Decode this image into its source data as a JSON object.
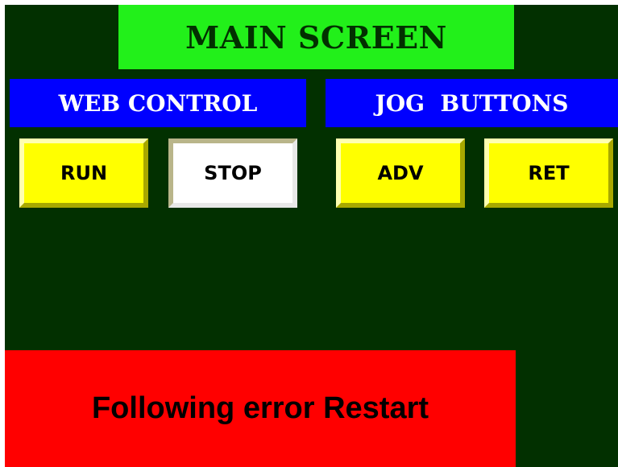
{
  "title": "MAIN SCREEN",
  "sections": {
    "web_control": "WEB CONTROL",
    "jog_buttons": "JOG  BUTTONS"
  },
  "buttons": {
    "run": "RUN",
    "stop": "STOP",
    "adv": "ADV",
    "ret": "RET"
  },
  "alarm": {
    "message": "Following error Restart"
  },
  "colors": {
    "background": "#023000",
    "title_bar": "#22f01a",
    "section_header": "#0000ff",
    "button_active": "#ffff00",
    "button_selected": "#ffffff",
    "alarm": "#ff0000"
  }
}
